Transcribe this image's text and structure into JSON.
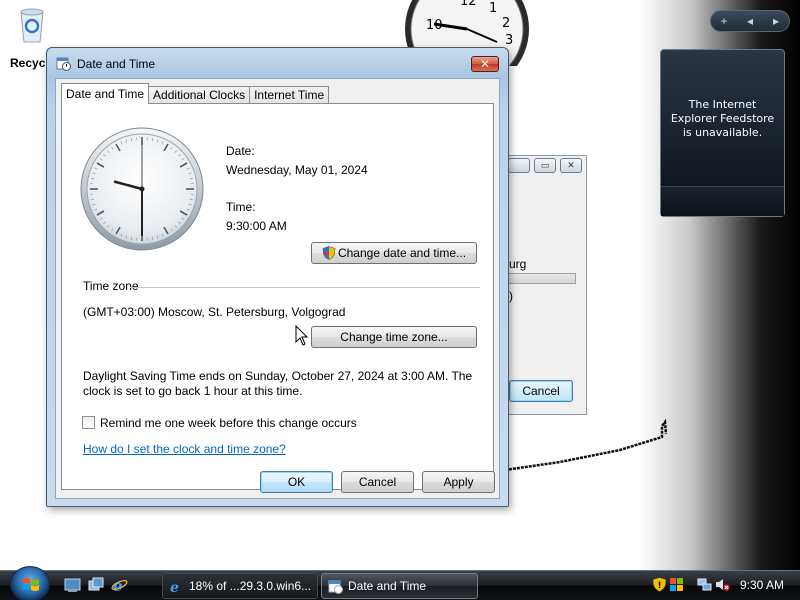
{
  "desktop": {
    "recycle_label": "Recycle Bin",
    "feed_message": "The Internet Explorer Feedstore is unavailable.",
    "sidebar_controls": [
      "+",
      "◂",
      "▸"
    ],
    "clock_gadget_numbers": [
      "10",
      "12",
      "1",
      "2",
      "3"
    ]
  },
  "background_window": {
    "text1": "urg",
    "text2": ")",
    "cancel_label": "Cancel"
  },
  "dialog": {
    "title": "Date and Time",
    "close_glyph": "✕",
    "tabs": [
      {
        "label": "Date and Time",
        "active": true
      },
      {
        "label": "Additional Clocks",
        "active": false
      },
      {
        "label": "Internet Time",
        "active": false
      }
    ],
    "date_label": "Date:",
    "date_value": "Wednesday, May 01, 2024",
    "time_label": "Time:",
    "time_value": "9:30:00 AM",
    "change_datetime_label": "Change date and time...",
    "timezone_heading": "Time zone",
    "timezone_value": "(GMT+03:00) Moscow, St. Petersburg, Volgograd",
    "change_timezone_label": "Change time zone...",
    "dst_line1": "Daylight Saving Time ends on Sunday, October 27, 2024 at 3:00 AM. The",
    "dst_line2": "clock is set to go back 1 hour at this time.",
    "remind_label": "Remind me one week before this change occurs",
    "remind_checked": false,
    "help_link": "How do I set the clock and time zone?",
    "ok_label": "OK",
    "cancel_label": "Cancel",
    "apply_label": "Apply"
  },
  "clock": {
    "hour": 9,
    "minute": 30,
    "second": 0
  },
  "taskbar": {
    "tasks": [
      {
        "label": "18% of ...29.3.0.win6...",
        "active": false
      },
      {
        "label": "Date and Time",
        "active": true
      }
    ],
    "time": "9:30 AM"
  },
  "colors": {
    "accent": "#3c7fb1",
    "link": "#0066cc",
    "title_close": "#c0391c"
  }
}
